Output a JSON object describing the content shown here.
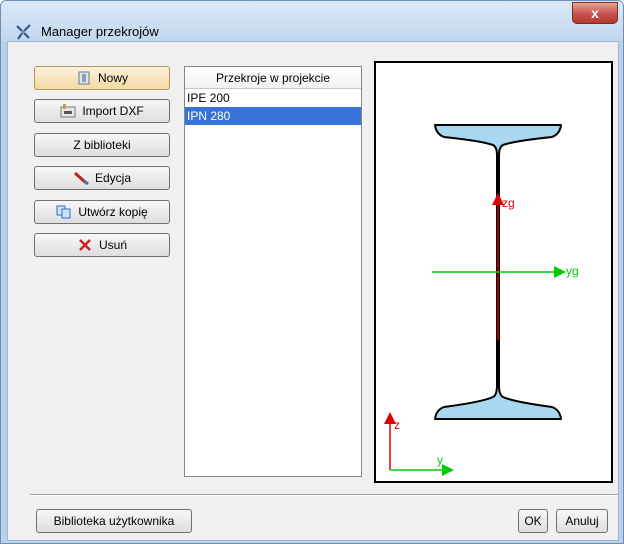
{
  "window": {
    "title": "Manager przekrojów",
    "close_label": "x"
  },
  "buttons": {
    "new": "Nowy",
    "import_dxf": "Import DXF",
    "from_library": "Z biblioteki",
    "edit": "Edycja",
    "copy": "Utwórz kopię",
    "delete": "Usuń"
  },
  "sections_list": {
    "header": "Przekroje w projekcie",
    "items": [
      "IPE 200",
      "IPN 280"
    ],
    "selected_index": 1
  },
  "preview": {
    "section_name": "IPN 280",
    "axis_zg": "zg",
    "axis_yg": "yg",
    "axis_z": "z",
    "axis_y": "y",
    "fill_color": "#a8d8f0",
    "axis_red": "#e00000",
    "axis_green": "#00cc00"
  },
  "footer": {
    "user_library": "Biblioteka użytkownika",
    "ok": "OK",
    "cancel": "Anuluj"
  }
}
